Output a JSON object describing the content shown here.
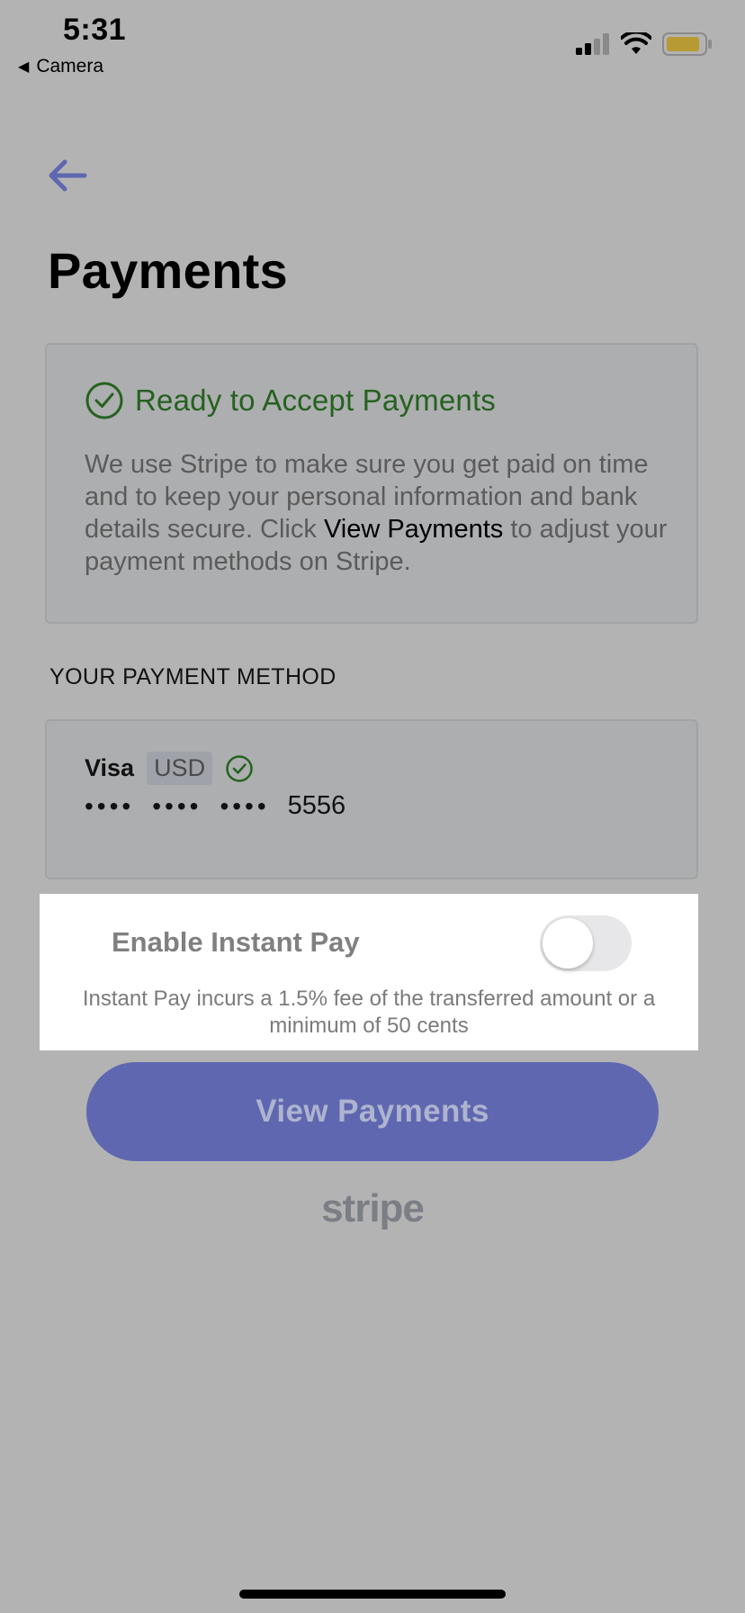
{
  "status_bar": {
    "time": "5:31",
    "back_app": "Camera",
    "icons": [
      "signal-icon",
      "wifi-icon",
      "battery-icon"
    ]
  },
  "header": {
    "back_icon": "arrow-left-icon",
    "title": "Payments"
  },
  "ready_card": {
    "title": "Ready to Accept Payments",
    "text_part1": "We use Stripe to make sure you get paid on time and to keep your personal information and bank details secure. Click ",
    "text_strong": "View Payments",
    "text_part2": " to adjust your payment methods on Stripe.",
    "icon": "check-circle-icon"
  },
  "payment_method": {
    "section_label": "YOUR PAYMENT METHOD",
    "brand": "Visa",
    "currency": "USD",
    "masked_groups": [
      "••••",
      "••••",
      "••••"
    ],
    "last4": "5556",
    "verified_icon": "check-circle-icon"
  },
  "instant_pay": {
    "label": "Enable Instant Pay",
    "enabled": false,
    "fee_text": "Instant Pay incurs a 1.5% fee of the transferred amount or a minimum of 50 cents"
  },
  "actions": {
    "view_payments": "View Payments"
  },
  "footer": {
    "logo_text": "stripe"
  },
  "colors": {
    "background": "#b3b3b3",
    "accent": "#5f67b0",
    "success": "#25621f",
    "highlight": "#ffffff"
  }
}
